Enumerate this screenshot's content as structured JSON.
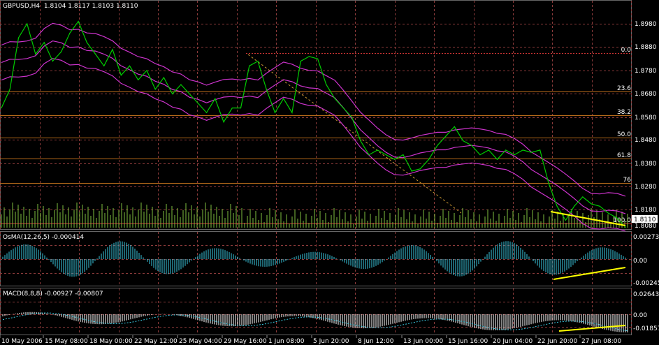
{
  "colors": {
    "background": "#000000",
    "grid": "#8b3a3a",
    "price_line": "#00cc00",
    "bands": "#cc33cc",
    "fib_lines": "#b86b1a",
    "volume": "#7fbf3f",
    "osma": "#3ac8e0",
    "macd_hist": "#ffffff",
    "macd_signal": "#3ac8e0",
    "divergence": "#ffff00",
    "price_tag_bg": "#ffffff",
    "price_tag_text": "#000000",
    "text": "#ffffff"
  },
  "main_panel": {
    "header": "GBPUSD,H4  1.8104 1.8117 1.8103 1.8110",
    "price_axis_labels": [
      "1.8980",
      "1.8880",
      "1.8780",
      "1.8680",
      "1.8580",
      "1.8480",
      "1.8380",
      "1.8280",
      "1.8180",
      "1.8080"
    ],
    "current_price_tag": "1.8110",
    "fib_labels": [
      "0.0",
      "23.6",
      "38.2",
      "50.0",
      "61.8",
      "76",
      "100.0"
    ]
  },
  "osma_panel": {
    "header": "OsMA(12,26,5) -0.000414",
    "axis_labels": [
      "0.00273",
      "0.00",
      "-0.00245"
    ]
  },
  "macd_panel": {
    "header": "MACD(8,8,8) -0.00927 -0.00807",
    "axis_labels": [
      "0.02643",
      "0.00",
      "-0.01857"
    ]
  },
  "time_axis_labels": [
    "10 May 2006",
    "15 May 08:00",
    "18 May 00:00",
    "22 May 12:00",
    "25 May 04:00",
    "29 May 16:00",
    "1 Jun 08:00",
    "5 Jun 20:00",
    "8 Jun 12:00",
    "13 Jun 00:00",
    "15 Jun 16:00",
    "20 Jun 04:00",
    "22 Jun 20:00",
    "27 Jun 08:00"
  ],
  "chart_data": {
    "type": "line",
    "title": "GBPUSD,H4",
    "series": [
      {
        "name": "GBPUSD",
        "values": [
          1.862,
          1.87,
          1.892,
          1.898,
          1.885,
          1.89,
          1.882,
          1.886,
          1.894,
          1.899,
          1.89,
          1.885,
          1.88,
          1.887,
          1.876,
          1.88,
          1.874,
          1.878,
          1.87,
          1.875,
          1.868,
          1.872,
          1.868,
          1.864,
          1.86,
          1.866,
          1.856,
          1.862,
          1.862,
          1.88,
          1.882,
          1.87,
          1.86,
          1.866,
          1.86,
          1.882,
          1.884,
          1.883,
          1.872,
          1.866,
          1.862,
          1.858,
          1.848,
          1.842,
          1.844,
          1.842,
          1.84,
          1.842,
          1.835,
          1.836,
          1.84,
          1.846,
          1.85,
          1.854,
          1.848,
          1.846,
          1.842,
          1.844,
          1.84,
          1.844,
          1.842,
          1.844,
          1.843,
          1.844,
          1.83,
          1.82,
          1.814,
          1.82,
          1.824,
          1.821,
          1.82,
          1.817,
          1.815,
          1.811
        ]
      }
    ]
  }
}
